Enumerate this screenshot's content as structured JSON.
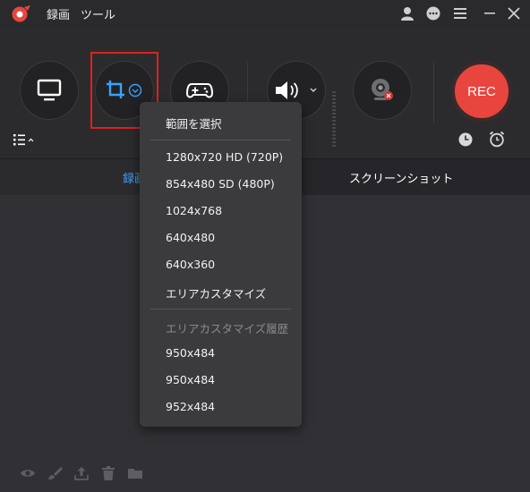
{
  "menu": {
    "record": "録画",
    "tools": "ツール"
  },
  "tabs": {
    "record": "録画",
    "screenshot": "スクリーンショット"
  },
  "rec_button": "REC",
  "dropdown": {
    "items": [
      {
        "label": "範囲を選択",
        "enabled": true
      },
      {
        "label": "1280x720 HD (720P)",
        "enabled": true
      },
      {
        "label": "854x480 SD (480P)",
        "enabled": true
      },
      {
        "label": "1024x768",
        "enabled": true
      },
      {
        "label": "640x480",
        "enabled": true
      },
      {
        "label": "640x360",
        "enabled": true
      },
      {
        "label": "エリアカスタマイズ",
        "enabled": true
      },
      {
        "label": "エリアカスタマイズ履歴",
        "enabled": false
      },
      {
        "label": "950x484",
        "enabled": true
      },
      {
        "label": "950x484",
        "enabled": true
      },
      {
        "label": "952x484",
        "enabled": true
      }
    ]
  },
  "colors": {
    "accent_blue": "#3aa2ff",
    "rec_red": "#e8453f",
    "highlight_red": "#e02020"
  },
  "icons": {
    "titlebar": [
      "user-icon",
      "chat-icon",
      "menu-icon",
      "minimize-icon",
      "close-icon"
    ],
    "toolbar": [
      "display-icon",
      "crop-icon",
      "gamepad-icon",
      "speaker-icon",
      "webcam-icon",
      "list-icon",
      "clock-icon",
      "alarm-icon"
    ],
    "bottom": [
      "eye-icon",
      "brush-icon",
      "upload-icon",
      "trash-icon",
      "folder-icon"
    ]
  }
}
